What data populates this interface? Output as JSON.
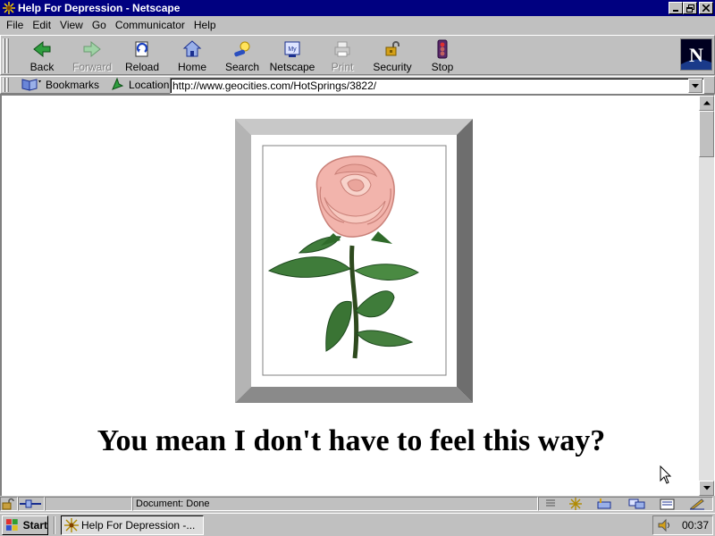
{
  "window": {
    "title": "Help For Depression - Netscape"
  },
  "menu": [
    "File",
    "Edit",
    "View",
    "Go",
    "Communicator",
    "Help"
  ],
  "navigation": {
    "back": "Back",
    "forward": "Forward",
    "reload": "Reload",
    "home": "Home",
    "search": "Search",
    "netscape": "Netscape",
    "print": "Print",
    "security": "Security",
    "stop": "Stop"
  },
  "location_bar": {
    "bookmarks_label": "Bookmarks",
    "location_label": "Location:",
    "url": "http://www.geocities.com/HotSprings/3822/"
  },
  "page": {
    "caption": "You mean I don't have to feel this way?",
    "image": "pink-rose"
  },
  "status": {
    "text": "Document: Done"
  },
  "taskbar": {
    "start_label": "Start",
    "task_label": "Help For Depression -...",
    "clock": "00:37"
  },
  "colors": {
    "titlebar": "#000080",
    "window_face": "#c0c0c0",
    "content_bg": "#ffffff"
  }
}
